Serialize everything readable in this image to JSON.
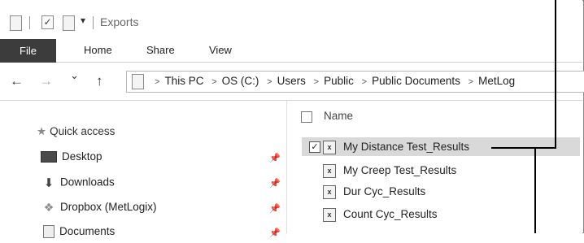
{
  "window": {
    "title": "Exports",
    "quick_access_arrow": "▾",
    "check_glyph": "✓"
  },
  "ribbon": {
    "tabs": [
      "File",
      "Home",
      "Share",
      "View"
    ]
  },
  "address_bar": {
    "back_icon": "←",
    "forward_icon": "→",
    "recent_icon": "⌄",
    "up_icon": "↑",
    "breadcrumbs": [
      "This PC",
      "OS (C:)",
      "Users",
      "Public",
      "Public Documents",
      "MetLog"
    ]
  },
  "nav_pane": {
    "quick_access_label": "Quick access",
    "items": [
      {
        "label": "Desktop",
        "icon": "desktop-icon",
        "pinned": true
      },
      {
        "label": "Downloads",
        "icon": "download-arrow-icon",
        "pinned": true
      },
      {
        "label": "Dropbox (MetLogix)",
        "icon": "dropbox-icon",
        "pinned": true
      },
      {
        "label": "Documents",
        "icon": "documents-icon",
        "pinned": true
      }
    ]
  },
  "file_list": {
    "column_header": "Name",
    "files": [
      {
        "name": "My Distance Test_Results",
        "selected": true,
        "checked": true
      },
      {
        "name": "My Creep Test_Results",
        "selected": false,
        "checked": false
      },
      {
        "name": "Dur Cyc_Results",
        "selected": false,
        "checked": false
      },
      {
        "name": "Count Cyc_Results",
        "selected": false,
        "checked": false
      }
    ],
    "excel_icon_glyph": "x"
  },
  "colors": {
    "file_tab_bg": "#3c3c3c",
    "selection_bg": "#d9d9d9",
    "callout_line": "#000000"
  }
}
